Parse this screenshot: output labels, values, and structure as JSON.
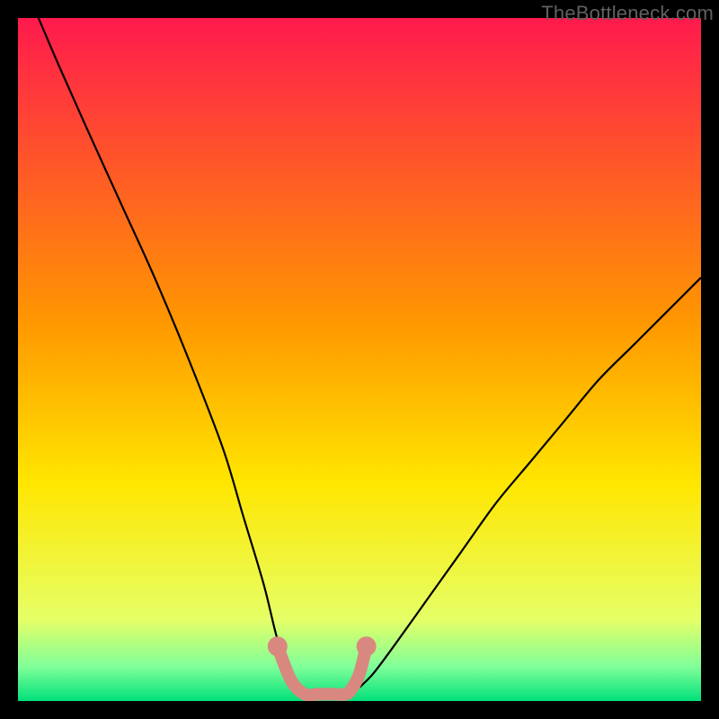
{
  "watermark": "TheBottleneck.com",
  "chart_data": {
    "type": "line",
    "title": "",
    "xlabel": "",
    "ylabel": "",
    "xlim": [
      0,
      100
    ],
    "ylim": [
      0,
      100
    ],
    "grid": false,
    "legend": false,
    "background_gradient": {
      "top_color": "#ff1a4d",
      "mid_color": "#ffe600",
      "low_color": "#e6ff66",
      "bottom_color": "#00e07a"
    },
    "series": [
      {
        "name": "left-curve",
        "stroke": "#000000",
        "x": [
          3,
          6,
          10,
          15,
          20,
          25,
          30,
          33,
          36,
          38,
          40,
          41
        ],
        "values": [
          100,
          93,
          84,
          73,
          62,
          50,
          37,
          27,
          17,
          9,
          4,
          2
        ]
      },
      {
        "name": "right-curve",
        "stroke": "#000000",
        "x": [
          50,
          52,
          55,
          60,
          65,
          70,
          75,
          80,
          85,
          90,
          95,
          100
        ],
        "values": [
          2,
          4,
          8,
          15,
          22,
          29,
          35,
          41,
          47,
          52,
          57,
          62
        ]
      },
      {
        "name": "valley-marker",
        "stroke": "#d98880",
        "x": [
          38,
          40,
          42,
          44,
          46,
          48,
          49,
          50,
          51
        ],
        "values": [
          8,
          3,
          1,
          1,
          1,
          1,
          2,
          4,
          8
        ]
      }
    ],
    "annotations": []
  }
}
